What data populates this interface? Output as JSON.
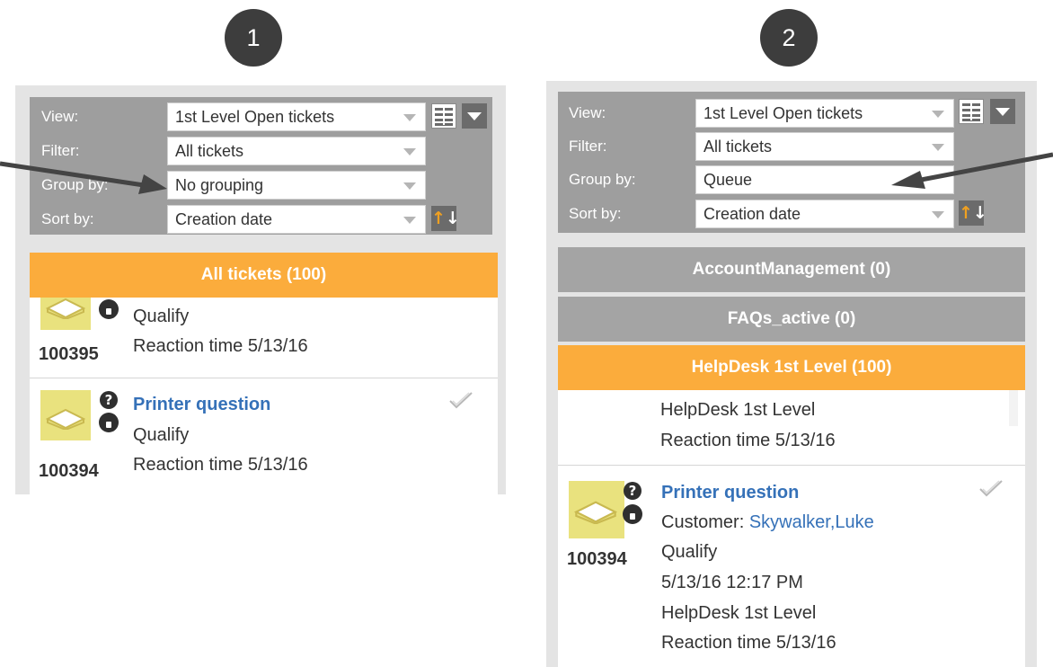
{
  "steps": [
    "1",
    "2"
  ],
  "labels": {
    "view": "View:",
    "filter": "Filter:",
    "group_by": "Group by:",
    "sort_by": "Sort by:"
  },
  "panel1": {
    "view": "1st Level Open tickets",
    "filter": "All tickets",
    "group_by": "No grouping",
    "sort_by": "Creation date",
    "group_bar": "All tickets (100)",
    "partial_ticket": {
      "id": "100395",
      "status": "Qualify",
      "reaction": "Reaction time  5/13/16"
    },
    "ticket": {
      "id": "100394",
      "title": "Printer question",
      "status": "Qualify",
      "reaction": "Reaction time  5/13/16"
    }
  },
  "panel2": {
    "view": "1st Level Open tickets",
    "filter": "All tickets",
    "group_by": "Queue",
    "sort_by": "Creation date",
    "groups": [
      "AccountManagement (0)",
      "FAQs_active (0)",
      "HelpDesk 1st Level (100)"
    ],
    "partial_ticket": {
      "queue": "HelpDesk 1st Level",
      "reaction": "Reaction time  5/13/16"
    },
    "ticket": {
      "id": "100394",
      "title": "Printer question",
      "customer_label": "Customer: ",
      "customer": "Skywalker,Luke",
      "status": "Qualify",
      "created": "5/13/16 12:17 PM",
      "queue": "HelpDesk 1st Level",
      "reaction": "Reaction time  5/13/16"
    }
  },
  "colors": {
    "accent_orange": "#fbac3c",
    "group_gray": "#a4a4a4",
    "filter_bg": "#9e9e9e",
    "link_blue": "#3571b8",
    "thumb_yellow": "#e9e27e"
  },
  "icons": [
    "grid-view-icon",
    "dropdown-arrow-icon",
    "sort-order-icon",
    "ticket-thumbnail-icon",
    "question-icon",
    "lock-icon",
    "check-icon",
    "arrow-pointer-icon"
  ]
}
